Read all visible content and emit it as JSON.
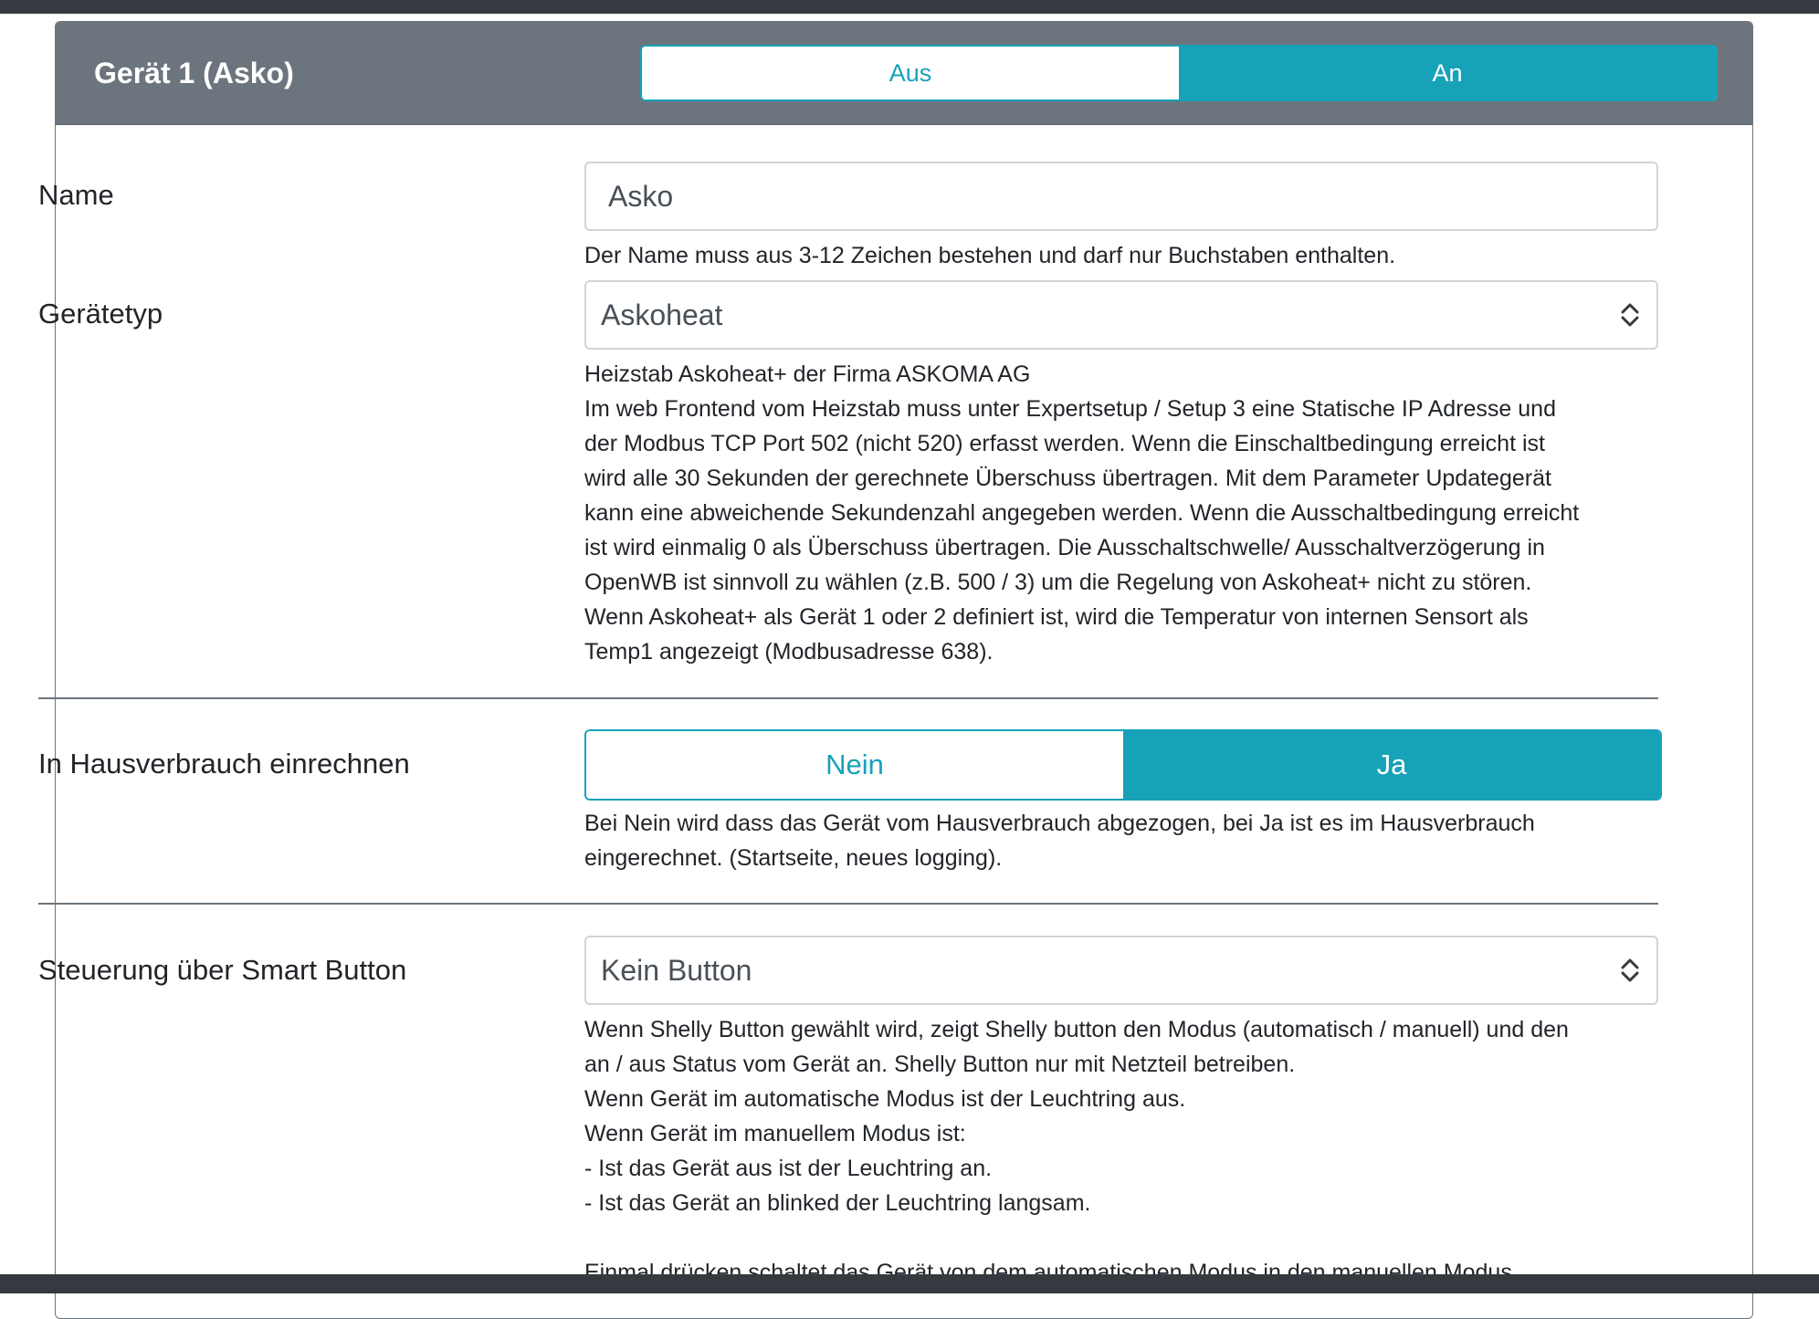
{
  "card": {
    "title": "Gerät 1 (Asko)",
    "toggle": {
      "off_label": "Aus",
      "on_label": "An",
      "selected": "An"
    }
  },
  "name_field": {
    "label": "Name",
    "value": "Asko",
    "help": "Der Name muss aus 3-12 Zeichen bestehen und darf nur Buchstaben enthalten."
  },
  "device_type": {
    "label": "Gerätetyp",
    "selected": "Askoheat",
    "help_lines": [
      "Heizstab Askoheat+ der Firma ASKOMA AG",
      "Im web Frontend vom Heizstab muss unter Expertsetup / Setup 3 eine Statische IP Adresse und",
      "der Modbus TCP Port 502 (nicht 520) erfasst werden. Wenn die Einschaltbedingung erreicht ist",
      "wird alle 30 Sekunden der gerechnete Überschuss übertragen. Mit dem Parameter Updategerät",
      "kann eine abweichende Sekundenzahl angegeben werden. Wenn die Ausschaltbedingung erreicht",
      "ist wird einmalig 0 als Überschuss übertragen. Die Ausschaltschwelle/ Ausschaltverzögerung in",
      "OpenWB ist sinnvoll zu wählen (z.B. 500 / 3) um die Regelung von Askoheat+ nicht zu stören.",
      "Wenn Askoheat+ als Gerät 1 oder 2 definiert ist, wird die Temperatur von internen Sensort als",
      "Temp1 angezeigt (Modbusadresse 638)."
    ]
  },
  "house_consumption": {
    "label": "In Hausverbrauch einrechnen",
    "no_label": "Nein",
    "yes_label": "Ja",
    "selected": "Ja",
    "help_lines": [
      "Bei Nein wird dass das Gerät vom Hausverbrauch abgezogen, bei Ja ist es im Hausverbrauch",
      "eingerechnet. (Startseite, neues logging)."
    ]
  },
  "smart_button": {
    "label": "Steuerung über Smart Button",
    "selected": "Kein Button",
    "help_lines": [
      "Wenn Shelly Button gewählt wird, zeigt Shelly button den Modus (automatisch / manuell) und den",
      "an / aus Status vom Gerät an. Shelly Button nur mit Netzteil betreiben.",
      "Wenn Gerät im automatische Modus ist der Leuchtring aus.",
      "Wenn Gerät im manuellem Modus ist:",
      "- Ist das Gerät aus ist der Leuchtring an.",
      "- Ist das Gerät an blinked der Leuchtring langsam.",
      "",
      "Einmal drücken schaltet das Gerät von dem automatischen Modus in den manuellen Modus"
    ]
  },
  "colors": {
    "accent": "#17a2b8",
    "header_bg": "#6c757d",
    "frame_dark": "#343a40"
  }
}
